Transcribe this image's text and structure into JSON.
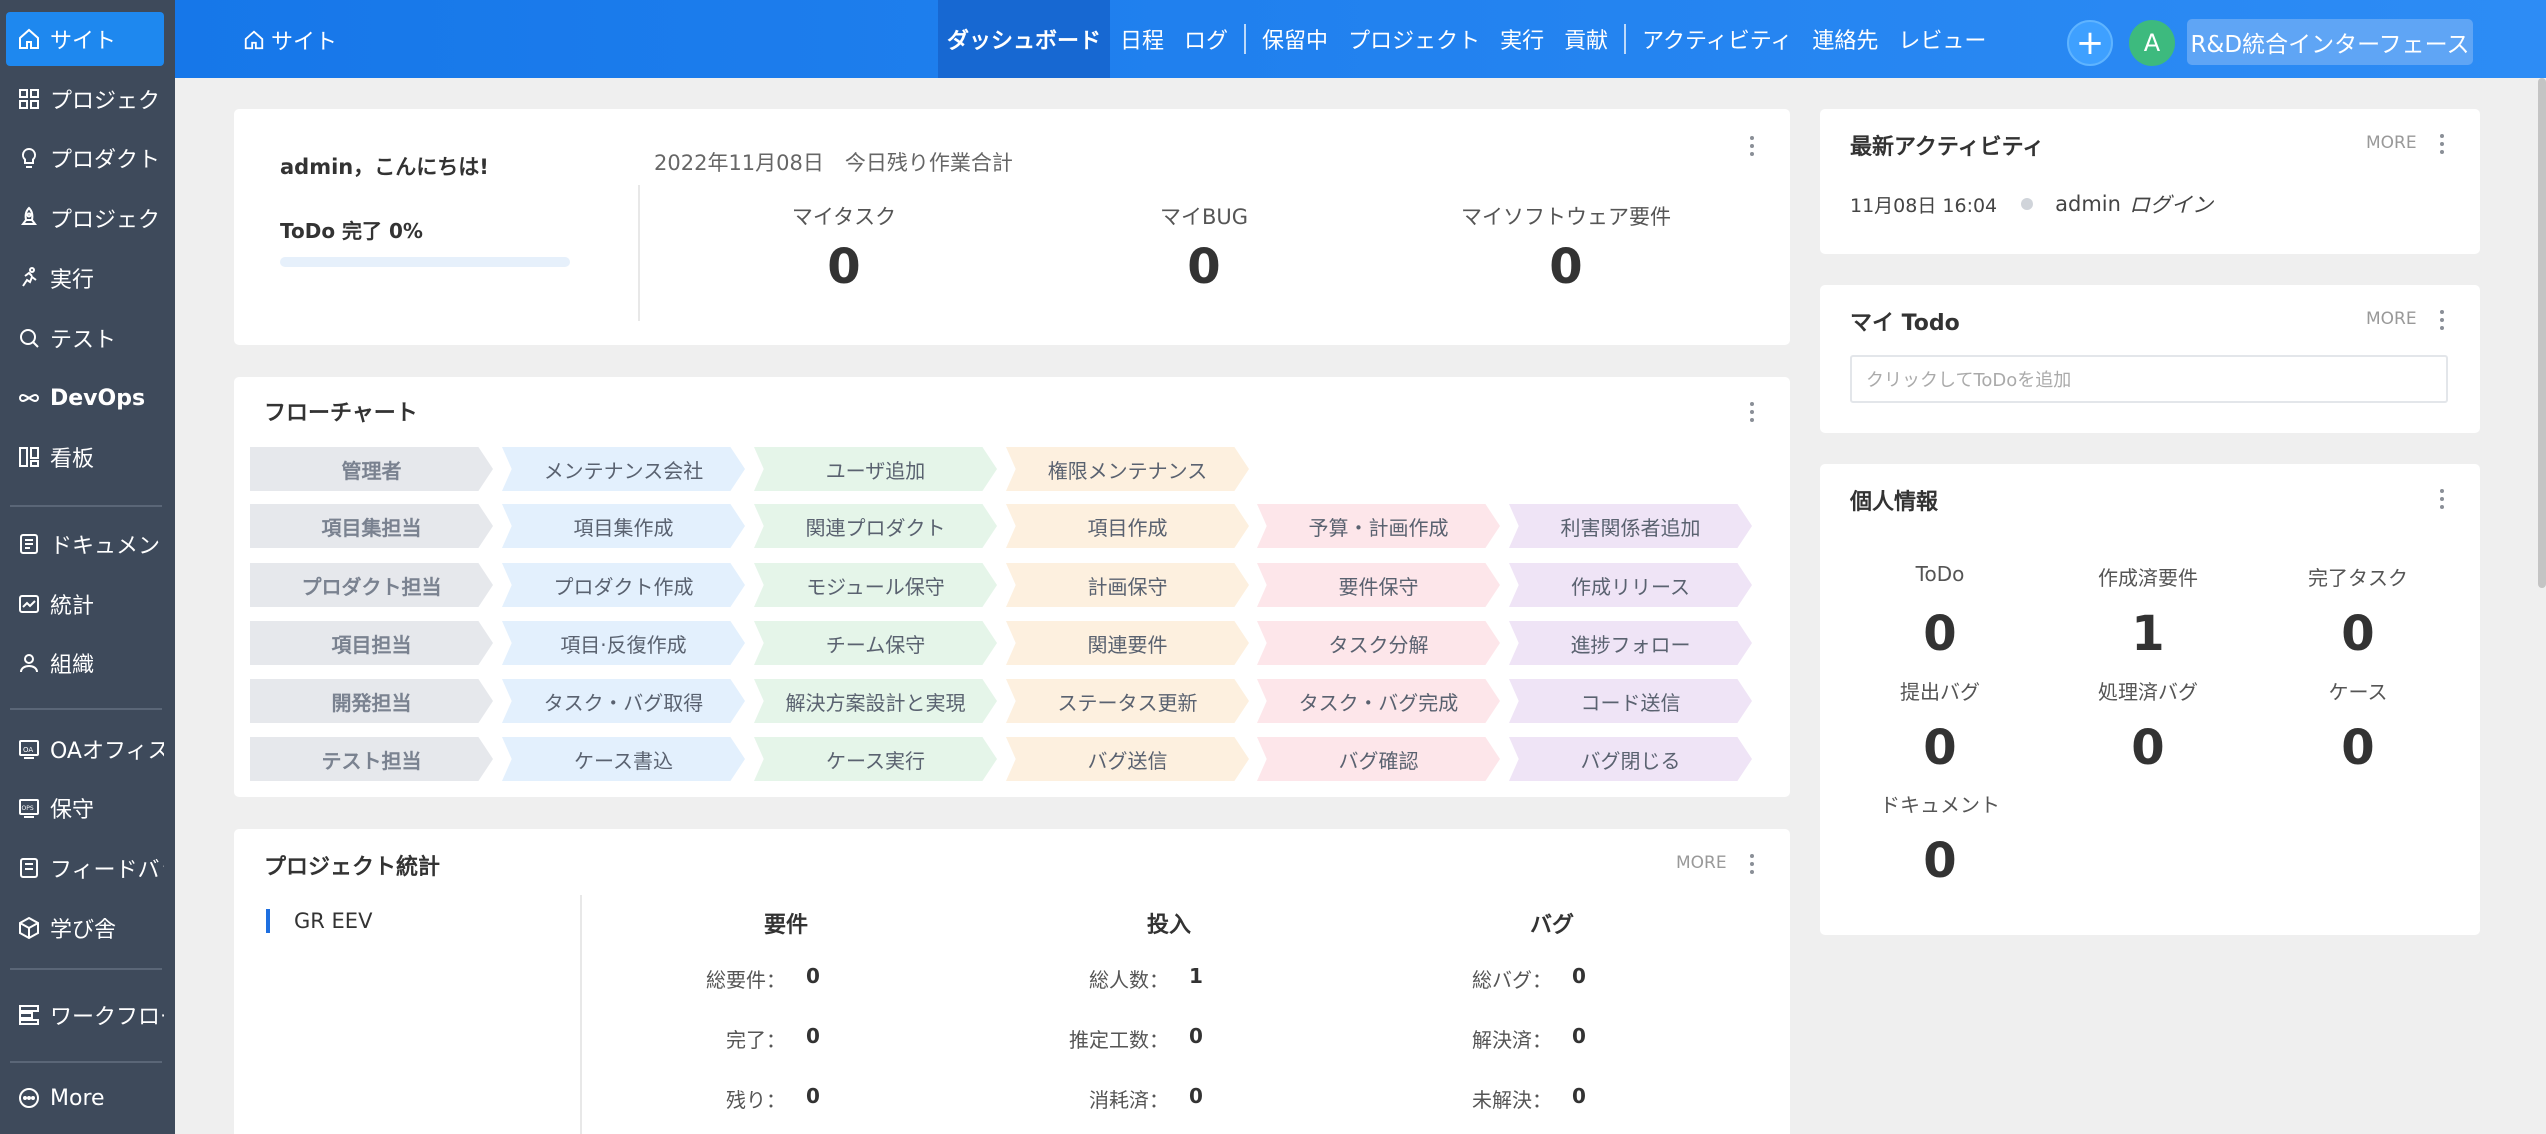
{
  "sidebar": {
    "items": [
      {
        "label": "サイト",
        "icon": "home-icon"
      },
      {
        "label": "プロジェクト",
        "icon": "grid-icon"
      },
      {
        "label": "プロダクト",
        "icon": "bulb-icon"
      },
      {
        "label": "プロジェクト",
        "icon": "rocket-icon"
      },
      {
        "label": "実行",
        "icon": "run-icon"
      },
      {
        "label": "テスト",
        "icon": "search-icon"
      },
      {
        "label": "DevOps",
        "icon": "infinity-icon"
      },
      {
        "label": "看板",
        "icon": "kanban-icon"
      },
      {
        "label": "ドキュメント",
        "icon": "document-icon"
      },
      {
        "label": "統計",
        "icon": "chart-icon"
      },
      {
        "label": "組織",
        "icon": "user-icon"
      },
      {
        "label": "OAオフィス",
        "icon": "oa-icon"
      },
      {
        "label": "保守",
        "icon": "ops-icon"
      },
      {
        "label": "フィードバック",
        "icon": "feedback-icon"
      },
      {
        "label": "学び舎",
        "icon": "cube-icon"
      },
      {
        "label": "ワークフロー",
        "icon": "workflow-icon"
      },
      {
        "label": "More",
        "icon": "more-icon"
      }
    ]
  },
  "header": {
    "breadcrumb": "サイト",
    "tabs": [
      "ダッシュボード",
      "日程",
      "ログ",
      "保留中",
      "プロジェクト",
      "実行",
      "貢献",
      "アクティビティ",
      "連絡先",
      "レビュー"
    ],
    "avatar_letter": "A",
    "interface_button": "R&D統合インターフェース"
  },
  "welcome": {
    "greeting": "admin，こんにちは!",
    "date_summary": "2022年11月08日　今日残り作業合計",
    "todo_progress_label": "ToDo 完了 0%",
    "todo_progress": 0,
    "stats": [
      {
        "label": "マイタスク",
        "value": "0"
      },
      {
        "label": "マイBUG",
        "value": "0"
      },
      {
        "label": "マイソフトウェア要件",
        "value": "0"
      }
    ]
  },
  "flowchart": {
    "title": "フローチャート",
    "rows": [
      {
        "role": "管理者",
        "steps": [
          "メンテナンス会社",
          "ユーザ追加",
          "権限メンテナンス"
        ]
      },
      {
        "role": "項目集担当",
        "steps": [
          "項目集作成",
          "関連プロダクト",
          "項目作成",
          "予算・計画作成",
          "利害関係者追加"
        ]
      },
      {
        "role": "プロダクト担当",
        "steps": [
          "プロダクト作成",
          "モジュール保守",
          "計画保守",
          "要件保守",
          "作成リリース"
        ]
      },
      {
        "role": "項目担当",
        "steps": [
          "項目·反復作成",
          "チーム保守",
          "関連要件",
          "タスク分解",
          "進捗フォロー"
        ]
      },
      {
        "role": "開発担当",
        "steps": [
          "タスク・バグ取得",
          "解決方案設計と実現",
          "ステータス更新",
          "タスク・バグ完成",
          "コード送信"
        ]
      },
      {
        "role": "テスト担当",
        "steps": [
          "ケース書込",
          "ケース実行",
          "バグ送信",
          "バグ確認",
          "バグ閉じる"
        ]
      }
    ],
    "colors": {
      "role": "#e6e8ec",
      "step1": "#e3f0fd",
      "step2": "#e5f5e9",
      "step3": "#fdf0df",
      "step4": "#fde6ea",
      "step5": "#efe4f6"
    }
  },
  "project_stats": {
    "title": "プロジェクト統計",
    "more": "MORE",
    "project": "GR EEV",
    "columns": [
      {
        "head": "要件",
        "rows": [
          [
            "総要件",
            "0"
          ],
          [
            "完了",
            "0"
          ],
          [
            "残り",
            "0"
          ]
        ]
      },
      {
        "head": "投入",
        "rows": [
          [
            "総人数",
            "1"
          ],
          [
            "推定工数",
            "0"
          ],
          [
            "消耗済",
            "0"
          ]
        ]
      },
      {
        "head": "バグ",
        "rows": [
          [
            "総バグ",
            "0"
          ],
          [
            "解決済",
            "0"
          ],
          [
            "未解決",
            "0"
          ]
        ]
      }
    ]
  },
  "activity": {
    "title": "最新アクティビティ",
    "more": "MORE",
    "time": "11月08日 16:04",
    "user": "admin",
    "action": "ログイン"
  },
  "todo": {
    "title": "マイ Todo",
    "more": "MORE",
    "placeholder": "クリックしてToDoを追加"
  },
  "personal": {
    "title": "個人情報",
    "items": [
      {
        "label": "ToDo",
        "value": "0"
      },
      {
        "label": "作成済要件",
        "value": "1"
      },
      {
        "label": "完了タスク",
        "value": "0"
      },
      {
        "label": "提出バグ",
        "value": "0"
      },
      {
        "label": "処理済バグ",
        "value": "0"
      },
      {
        "label": "ケース",
        "value": "0"
      },
      {
        "label": "ドキュメント",
        "value": "0"
      }
    ]
  }
}
